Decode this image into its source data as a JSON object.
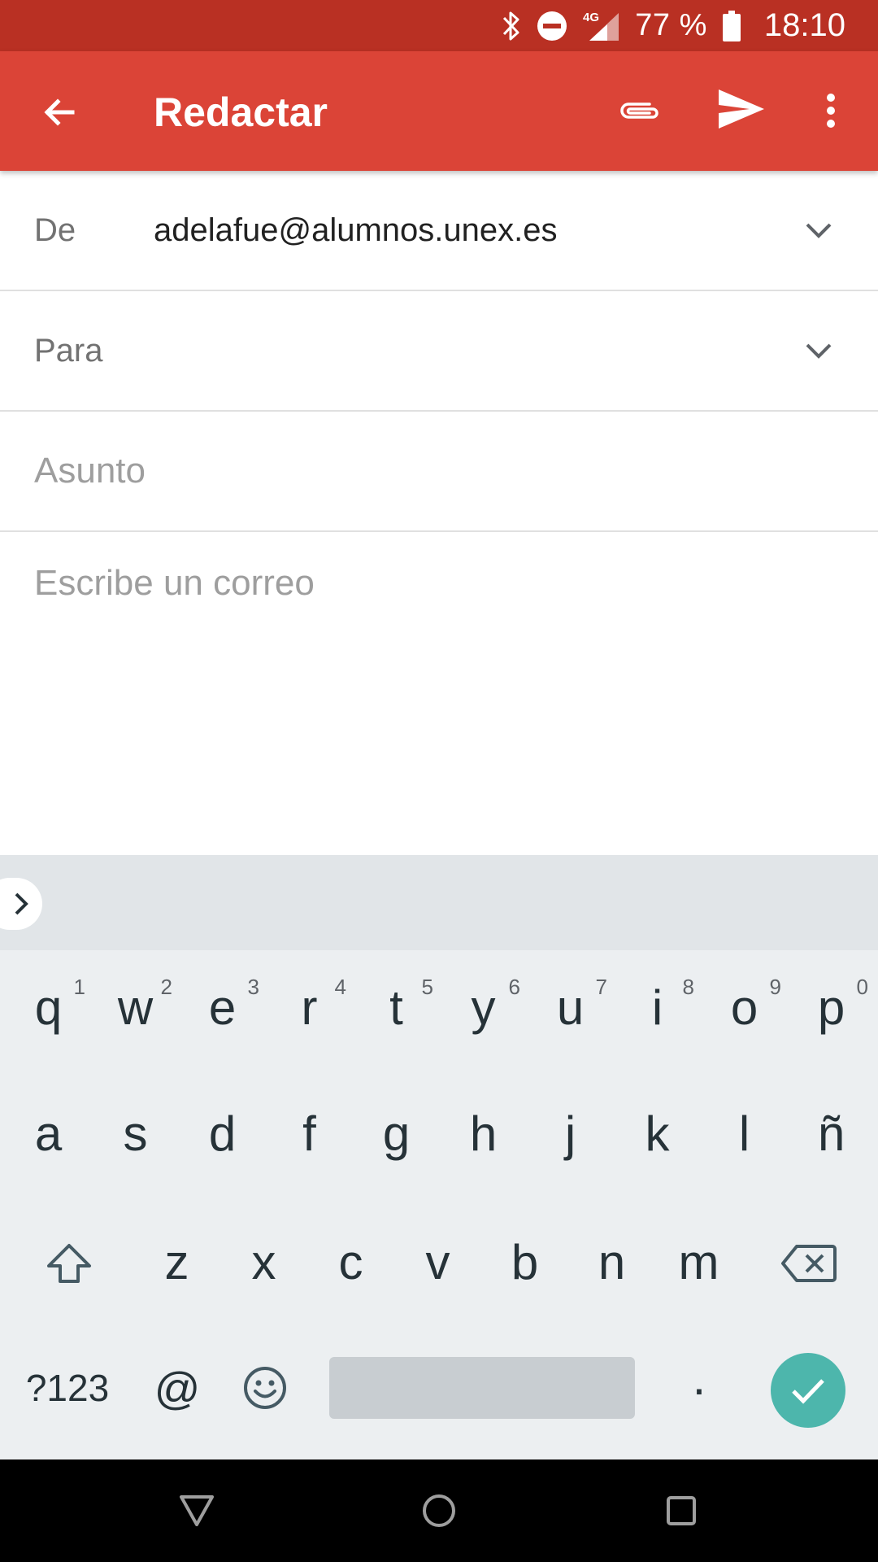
{
  "status_bar": {
    "network": "4G",
    "battery_text": "77 %",
    "time": "18:10",
    "icons": [
      "bluetooth-icon",
      "do-not-disturb-icon",
      "signal-icon",
      "battery-icon"
    ]
  },
  "app_bar": {
    "title": "Redactar",
    "icons": [
      "back-arrow-icon",
      "attach-icon",
      "send-icon",
      "more-vert-icon"
    ],
    "color": "#db4437"
  },
  "form": {
    "from_label": "De",
    "from_value": "adelafue@alumnos.unex.es",
    "to_label": "Para",
    "subject_placeholder": "Asunto",
    "body_placeholder": "Escribe un correo"
  },
  "keyboard": {
    "row1": [
      {
        "key": "q",
        "num": "1"
      },
      {
        "key": "w",
        "num": "2"
      },
      {
        "key": "e",
        "num": "3"
      },
      {
        "key": "r",
        "num": "4"
      },
      {
        "key": "t",
        "num": "5"
      },
      {
        "key": "y",
        "num": "6"
      },
      {
        "key": "u",
        "num": "7"
      },
      {
        "key": "i",
        "num": "8"
      },
      {
        "key": "o",
        "num": "9"
      },
      {
        "key": "p",
        "num": "0"
      }
    ],
    "row2": [
      "a",
      "s",
      "d",
      "f",
      "g",
      "h",
      "j",
      "k",
      "l",
      "ñ"
    ],
    "row3": [
      "z",
      "x",
      "c",
      "v",
      "b",
      "n",
      "m"
    ],
    "symbols_label": "?123",
    "at_label": "@",
    "period_label": ".",
    "accent_color": "#4db6ac",
    "icons": [
      "expand-toolbar-icon",
      "shift-icon",
      "backspace-icon",
      "emoji-icon",
      "check-icon"
    ]
  },
  "nav_bar": {
    "icons": [
      "nav-back-icon",
      "nav-home-icon",
      "nav-recents-icon"
    ]
  }
}
